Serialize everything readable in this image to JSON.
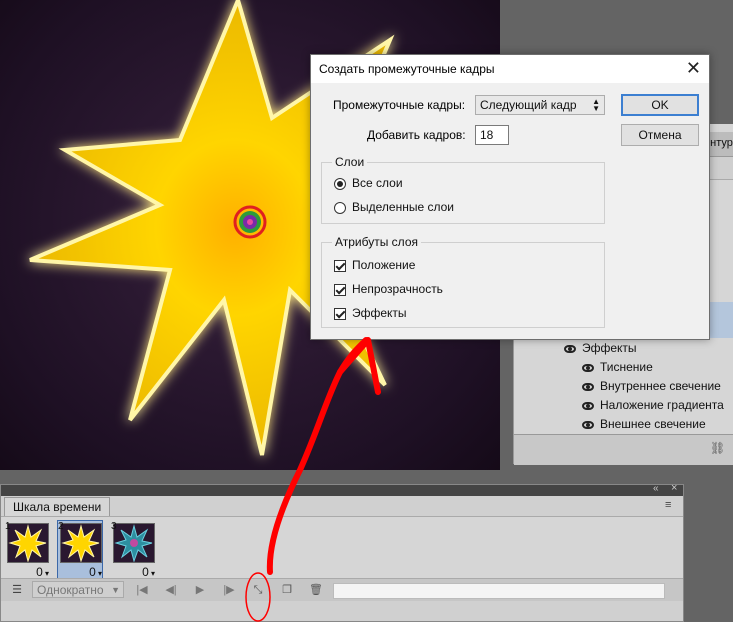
{
  "dialog": {
    "title": "Создать промежуточные кадры",
    "tween_label": "Промежуточные кадры:",
    "tween_value": "Следующий кадр",
    "add_frames_label": "Добавить кадров:",
    "add_frames_value": "18",
    "ok": "OK",
    "cancel": "Отмена",
    "layers_group": {
      "title": "Слои",
      "all_layers": "Все слои",
      "selected_layers": "Выделенные слои",
      "selected_option": "all_layers"
    },
    "attributes_group": {
      "title": "Атрибуты слоя",
      "position": "Положение",
      "opacity": "Непрозрачность",
      "effects": "Эффекты",
      "position_checked": true,
      "opacity_checked": true,
      "effects_checked": true
    }
  },
  "layers_panel": {
    "tab_label": "онтуры",
    "effects_label": "Эффекты",
    "effects": [
      "Тиснение",
      "Внутреннее свечение",
      "Наложение градиента",
      "Внешнее свечение"
    ]
  },
  "timeline": {
    "tab_label": "Шкала времени",
    "loop_option": "Однократно",
    "frames": [
      {
        "number": "1",
        "delay": "0",
        "selected": false
      },
      {
        "number": "2",
        "delay": "0",
        "selected": true
      },
      {
        "number": "3",
        "delay": "0",
        "selected": false
      }
    ]
  },
  "colors": {
    "star": "#ffd500",
    "glow": "#fff6a8",
    "background": "#1e1024",
    "annotation": "#ff0000",
    "ok_border": "#3c7fd1",
    "selected_frame": "#a9bfdc"
  }
}
